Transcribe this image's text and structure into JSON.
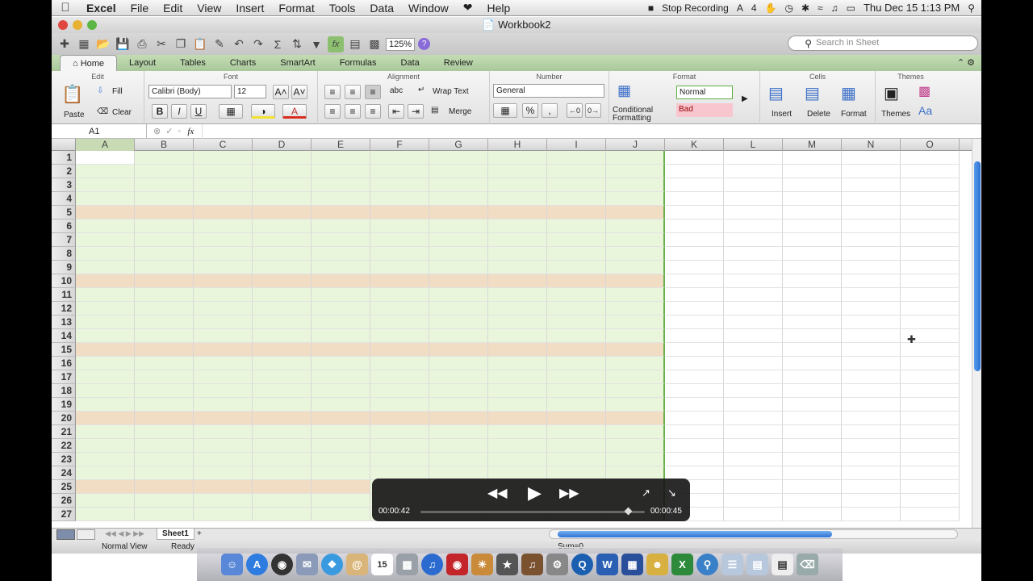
{
  "menubar": {
    "app": "Excel",
    "items": [
      "File",
      "Edit",
      "View",
      "Insert",
      "Format",
      "Tools",
      "Data",
      "Window",
      "Help"
    ],
    "recording": "Stop Recording",
    "clock": "Thu Dec 15  1:13 PM",
    "badge": "4"
  },
  "window": {
    "title": "Workbook2"
  },
  "toolbar": {
    "zoom": "125%",
    "search_placeholder": "Search in Sheet"
  },
  "ribbon": {
    "tabs": [
      "Home",
      "Layout",
      "Tables",
      "Charts",
      "SmartArt",
      "Formulas",
      "Data",
      "Review"
    ],
    "groups": {
      "edit": "Edit",
      "font": "Font",
      "alignment": "Alignment",
      "number": "Number",
      "format": "Format",
      "cells": "Cells",
      "themes": "Themes"
    },
    "paste": "Paste",
    "fill": "Fill",
    "clear": "Clear",
    "font_name": "Calibri (Body)",
    "font_size": "12",
    "bold": "B",
    "italic": "I",
    "underline": "U",
    "wrap_text": "Wrap Text",
    "merge": "Merge",
    "abc": "abc",
    "number_format": "General",
    "percent": "%",
    "comma": ",",
    "conditional": "Conditional",
    "formatting": "Formatting",
    "style_normal": "Normal",
    "style_bad": "Bad",
    "insert": "Insert",
    "delete": "Delete",
    "format_btn": "Format",
    "themes": "Themes",
    "aa": "Aa"
  },
  "formula_bar": {
    "namebox": "A1",
    "fx": "fx",
    "value": ""
  },
  "grid": {
    "columns": [
      "A",
      "B",
      "C",
      "D",
      "E",
      "F",
      "G",
      "H",
      "I",
      "J",
      "K",
      "L",
      "M",
      "N",
      "O"
    ],
    "rows": [
      "1",
      "2",
      "3",
      "4",
      "5",
      "6",
      "7",
      "8",
      "9",
      "10",
      "11",
      "12",
      "13",
      "14",
      "15",
      "16",
      "17",
      "18",
      "19",
      "20",
      "21",
      "22",
      "23",
      "24",
      "25",
      "26",
      "27"
    ],
    "band_rows": [
      5,
      10,
      15,
      20,
      25
    ],
    "colors": {
      "light_green": "#eaf6dc",
      "tan": "#f1dcc4"
    }
  },
  "sheets": {
    "tab": "Sheet1",
    "add": "+"
  },
  "status": {
    "view": "Normal View",
    "state": "Ready",
    "sum": "Sum=0"
  },
  "video": {
    "elapsed": "00:00:42",
    "duration": "00:00:45"
  },
  "dock_badges": {
    "calendar": "15",
    "word": "W",
    "excel": "X"
  }
}
